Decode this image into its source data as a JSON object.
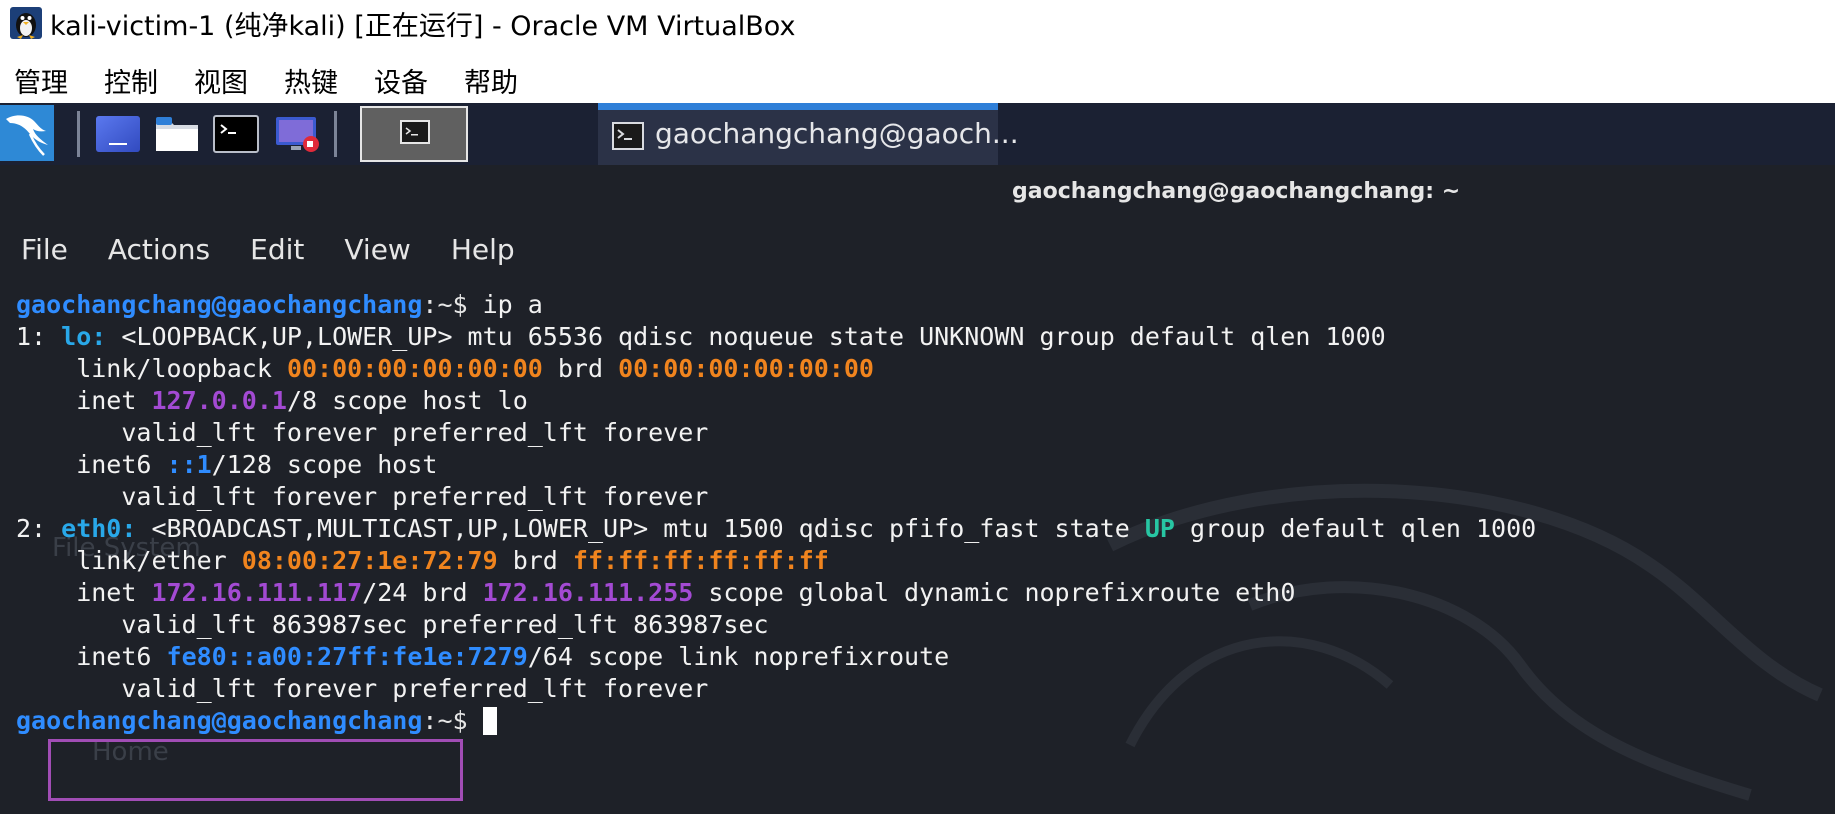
{
  "window": {
    "title": "kali-victim-1 (纯净kali) [正在运行] - Oracle VM VirtualBox"
  },
  "menubar": {
    "items": [
      "管理",
      "控制",
      "视图",
      "热键",
      "设备",
      "帮助"
    ]
  },
  "taskbar": {
    "active_task_label": "gaochangchang@gaoch..."
  },
  "terminal": {
    "title": "gaochangchang@gaochangchang: ~",
    "menu": [
      "File",
      "Actions",
      "Edit",
      "View",
      "Help"
    ],
    "prompt_user": "gaochangchang@gaochangchang",
    "prompt_path": ":~$",
    "command": " ip a",
    "l1": {
      "pre": "1: ",
      "iface": "lo:",
      "rest": " <LOOPBACK,UP,LOWER_UP> mtu 65536 qdisc noqueue state UNKNOWN group default qlen 1000"
    },
    "l2": {
      "pre": "    link/loopback ",
      "mac1": "00:00:00:00:00:00",
      "mid": " brd ",
      "mac2": "00:00:00:00:00:00"
    },
    "l3": {
      "pre": "    inet ",
      "ip": "127.0.0.1",
      "rest": "/8 scope host lo"
    },
    "l4": "       valid_lft forever preferred_lft forever",
    "l5": {
      "pre": "    inet6 ",
      "ip": "::1",
      "rest": "/128 scope host"
    },
    "l6": "       valid_lft forever preferred_lft forever",
    "l7": {
      "pre": "2: ",
      "iface": "eth0:",
      "mid": " <BROADCAST,MULTICAST,UP,LOWER_UP> mtu 1500 qdisc pfifo_fast state ",
      "state": "UP",
      "rest": " group default qlen 1000"
    },
    "l8": {
      "pre": "    link/ether ",
      "mac1": "08:00:27:1e:72:79",
      "mid": " brd ",
      "mac2": "ff:ff:ff:ff:ff:ff"
    },
    "l9": {
      "pre": "    inet ",
      "ip": "172.16.111.117",
      "mid": "/24 brd ",
      "brd": "172.16.111.255",
      "rest": " scope global dynamic noprefixroute eth0"
    },
    "l10": "       valid_lft 863987sec preferred_lft 863987sec",
    "l11": {
      "pre": "    inet6 ",
      "ip": "fe80::a00:27ff:fe1e:7279",
      "rest": "/64 scope link noprefixroute"
    },
    "l12": "       valid_lft forever preferred_lft forever"
  },
  "desktop_ghost": {
    "filesystem": "File System",
    "home": "Home"
  },
  "colors": {
    "panel": "#1b2133",
    "terminal_bg": "#1e2128",
    "prompt": "#2f8cff",
    "mac": "#f0841e",
    "ipv4": "#a34ad3",
    "highlight": "#a14db5"
  }
}
